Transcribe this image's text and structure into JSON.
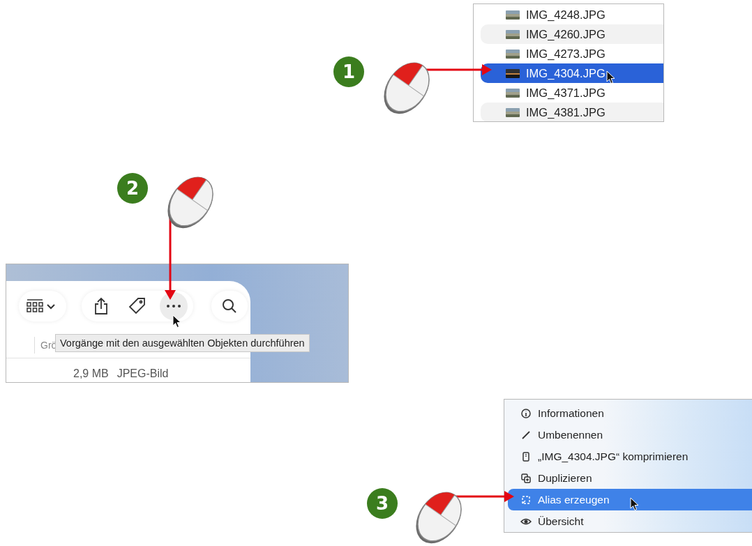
{
  "steps": [
    {
      "number": "1"
    },
    {
      "number": "2"
    },
    {
      "number": "3"
    }
  ],
  "file_list": {
    "rows": [
      {
        "name": "IMG_4248.JPG",
        "selected": false
      },
      {
        "name": "IMG_4260.JPG",
        "selected": false
      },
      {
        "name": "IMG_4273.JPG",
        "selected": false
      },
      {
        "name": "IMG_4304.JPG",
        "selected": true
      },
      {
        "name": "IMG_4371.JPG",
        "selected": false
      },
      {
        "name": "IMG_4381.JPG",
        "selected": false
      }
    ]
  },
  "finder_toolbar": {
    "column_header": "Grö",
    "tooltip": "Vorgänge mit den ausgewählten Objekten durchführen",
    "size": "2,9 MB",
    "kind": "JPEG-Bild"
  },
  "context_menu": {
    "items": [
      {
        "label": "Informationen",
        "kind": "info",
        "selected": false
      },
      {
        "label": "Umbenennen",
        "kind": "rename",
        "selected": false
      },
      {
        "label": "„IMG_4304.JPG“ komprimieren",
        "kind": "compress",
        "selected": false
      },
      {
        "label": "Duplizieren",
        "kind": "duplicate",
        "selected": false
      },
      {
        "label": "Alias erzeugen",
        "kind": "alias",
        "selected": true
      },
      {
        "label": "Übersicht",
        "kind": "preview",
        "selected": false
      }
    ]
  }
}
